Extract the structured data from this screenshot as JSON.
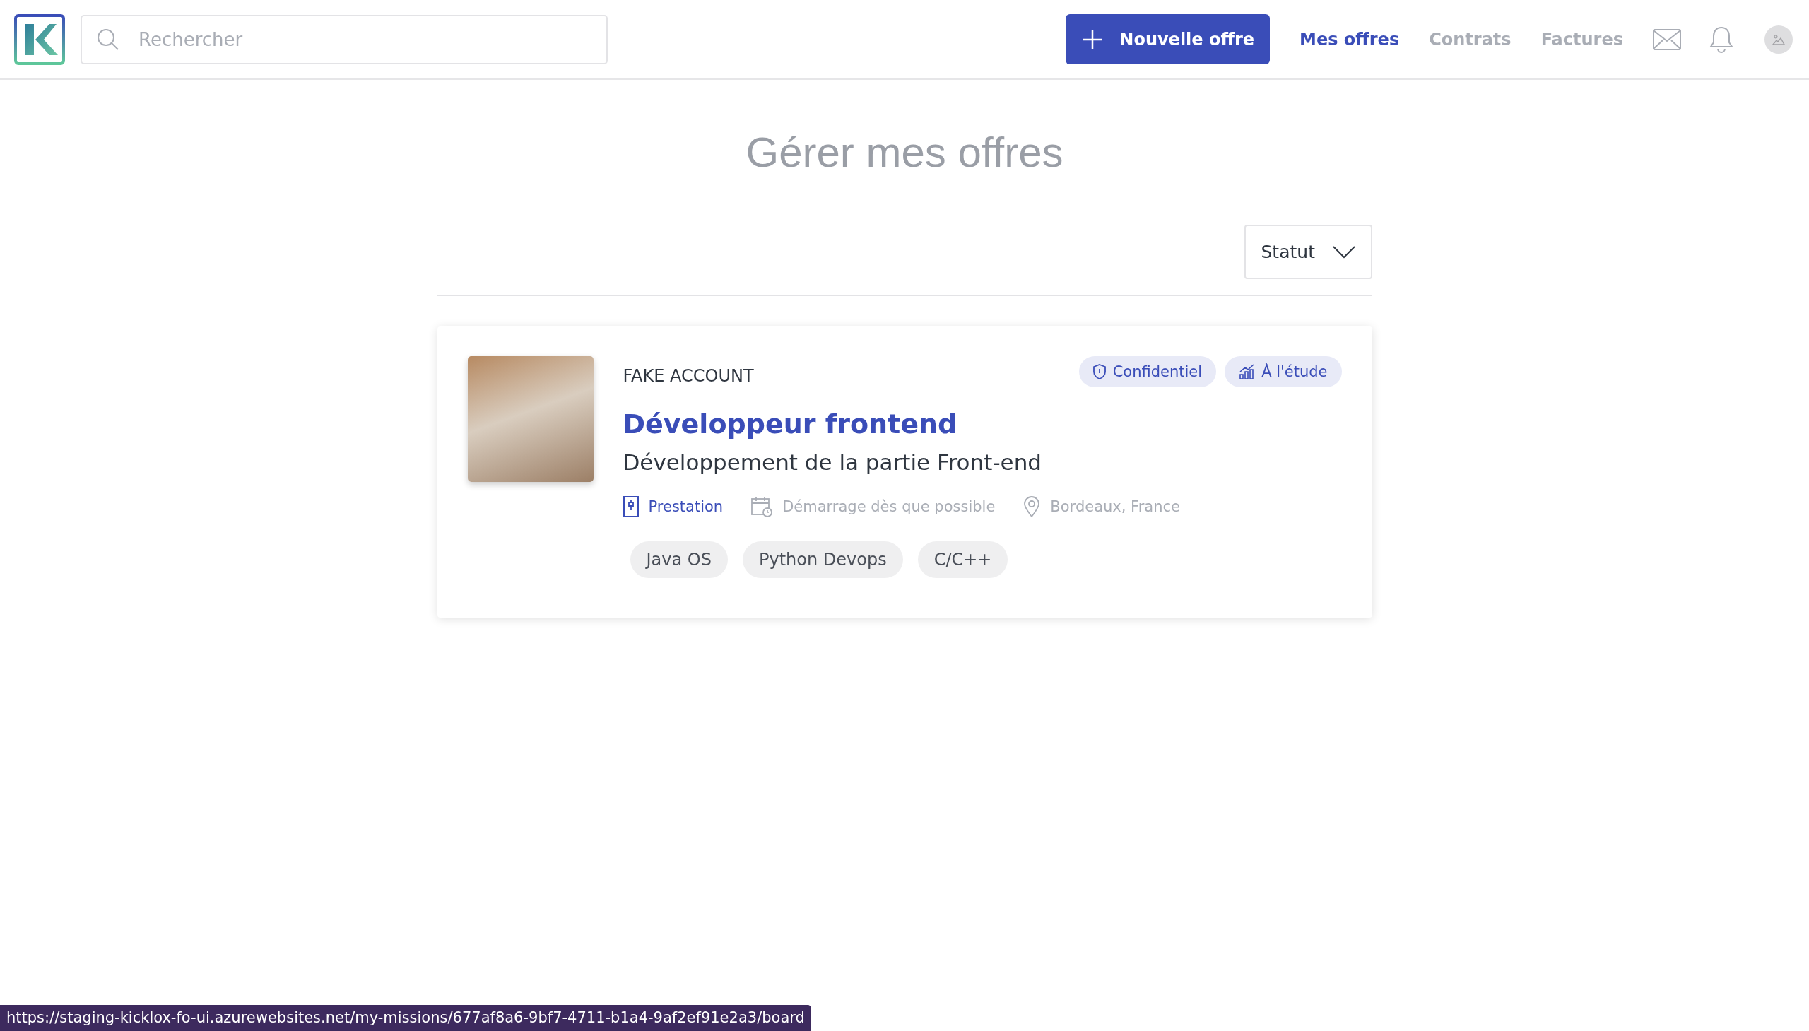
{
  "header": {
    "search": {
      "placeholder": "Rechercher"
    },
    "new_button": "Nouvelle offre",
    "nav": [
      {
        "label": "Mes offres",
        "selected": true
      },
      {
        "label": "Contrats",
        "selected": false
      },
      {
        "label": "Factures",
        "selected": false
      }
    ]
  },
  "page_title": "Gérer mes offres",
  "filter": {
    "label": "Statut"
  },
  "offers": [
    {
      "company": "FAKE ACCOUNT",
      "title": "Développeur frontend",
      "subtitle": "Développement de la partie Front-end",
      "badges": [
        {
          "kind": "confidential",
          "label": "Confidentiel"
        },
        {
          "kind": "status",
          "label": "À l'étude"
        }
      ],
      "meta": [
        {
          "kind": "contract",
          "label": "Prestation"
        },
        {
          "kind": "start",
          "label": "Démarrage dès que possible"
        },
        {
          "kind": "location",
          "label": "Bordeaux, France"
        }
      ],
      "skills": [
        "Java OS",
        "Python Devops",
        "C/C++"
      ]
    }
  ],
  "status_bar": "https://staging-kicklox-fo-ui.azurewebsites.net/my-missions/677af8a6-9bf7-4711-b1a4-9af2ef91e2a3/board"
}
